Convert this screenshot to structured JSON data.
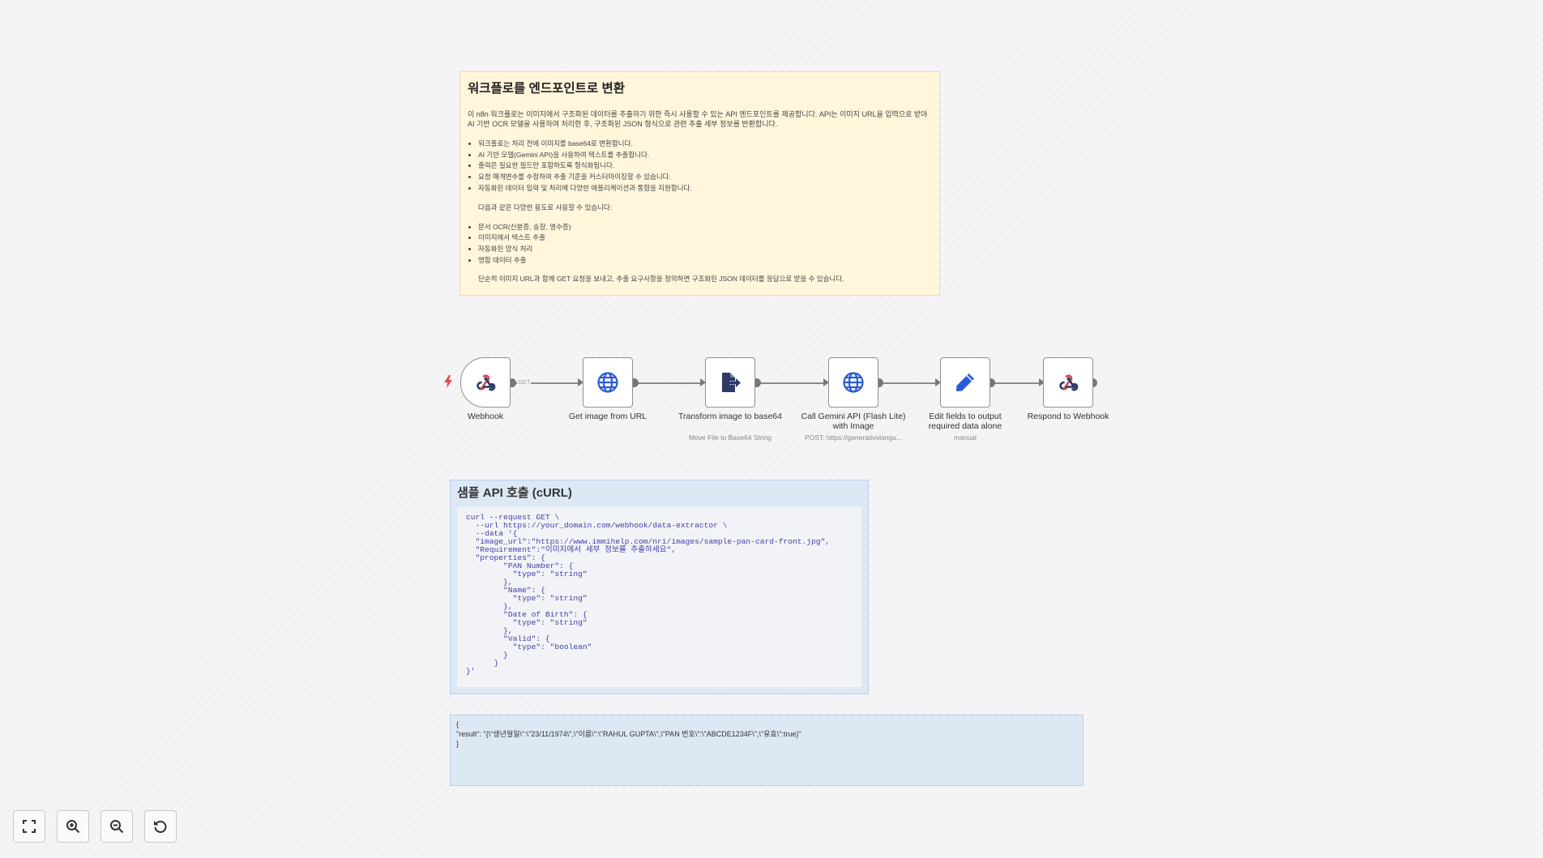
{
  "sticky_top": {
    "title": "워크플로를 엔드포인트로 변환",
    "intro": "이 n8n 워크플로는 이미지에서 구조화된 데이터를 추출하기 위한 즉시 사용할 수 있는 API 엔드포인트를 제공합니다. API는 이미지 URL을 입력으로 받아 AI 기반 OCR 모델을 사용하여 처리한 후, 구조화된 JSON 형식으로 관련 추출 세부 정보를 반환합니다.",
    "features": [
      "워크플로는 처리 전에 이미지를 base64로 변환합니다.",
      "AI 기반 모델(Gemini API)을 사용하여 텍스트를 추출합니다.",
      "출력은 필요한 필드만 포함하도록 형식화됩니다.",
      "요청 매개변수를 수정하여 추출 기준을 커스터마이징할 수 있습니다.",
      "자동화된 데이터 입력 및 처리에 다양한 애플리케이션과 통합을 지원합니다."
    ],
    "uses_intro": "다음과 같은 다양한 용도로 사용할 수 있습니다:",
    "uses": [
      "문서 OCR(신분증, 송장, 영수증)",
      "이미지에서 텍스트 추출",
      "자동화된 양식 처리",
      "명함 데이터 추출"
    ],
    "closing": "단순히 이미지 URL과 함께 GET 요청을 보내고, 추출 요구사항을 정의하면 구조화된 JSON 데이터를 응답으로 받을 수 있습니다."
  },
  "nodes": [
    {
      "label": "Webhook",
      "sub": "",
      "icon": "webhook-icon"
    },
    {
      "label": "Get image from URL",
      "sub": "",
      "icon": "globe-icon"
    },
    {
      "label": "Transform image to base64",
      "sub": "Move File to Base64 String",
      "icon": "file-export-icon"
    },
    {
      "label": "Call Gemini API (Flash Lite) with Image",
      "sub": "POST: https://generativelangu...",
      "icon": "globe-icon"
    },
    {
      "label": "Edit fields to output required data alone",
      "sub": "manual",
      "icon": "pencil-icon"
    },
    {
      "label": "Respond to Webhook",
      "sub": "",
      "icon": "webhook-icon"
    }
  ],
  "connection_label": "GET",
  "sticky_curl": {
    "title": "샘플 API 호출 (cURL)",
    "code": "curl --request GET \\\n  --url https://your_domain.com/webhook/data-extractor \\\n  --data '{\n  \"image_url\":\"https://www.immihelp.com/nri/images/sample-pan-card-front.jpg\",\n  \"Requirement\":\"이미지에서 세부 정보를 추출하세요\",\n  \"properties\": {\n        \"PAN Number\": {\n          \"type\": \"string\"\n        },\n        \"Name\": {\n          \"type\": \"string\"\n        },\n        \"Date of Birth\": {\n          \"type\": \"string\"\n        },\n        \"Valid\": {\n          \"type\": \"boolean\"\n        }\n      }\n}'"
  },
  "sticky_result": {
    "text": "{\n\"result\": \"{\\\"생년월일\\\":\\\"23/11/1974\\\",\\\"이름\\\":\\\"RAHUL GUPTA\\\",\\\"PAN 번호\\\":\\\"ABCDE1234F\\\",\\\"유효\\\":true}\"\n}"
  },
  "controls": [
    {
      "name": "fit-view-button",
      "icon": "expand-icon"
    },
    {
      "name": "zoom-in-button",
      "icon": "zoom-in-icon"
    },
    {
      "name": "zoom-out-button",
      "icon": "zoom-out-icon"
    },
    {
      "name": "reset-zoom-button",
      "icon": "undo-icon"
    }
  ],
  "colors": {
    "sticky_yellow": "#fff6dc",
    "sticky_blue": "#dde8f5",
    "icon_dark": "#2d3a66",
    "icon_blue": "#2a5bd7",
    "webhook_red": "#d34b5f",
    "trigger_bolt": "#e34d4d"
  }
}
